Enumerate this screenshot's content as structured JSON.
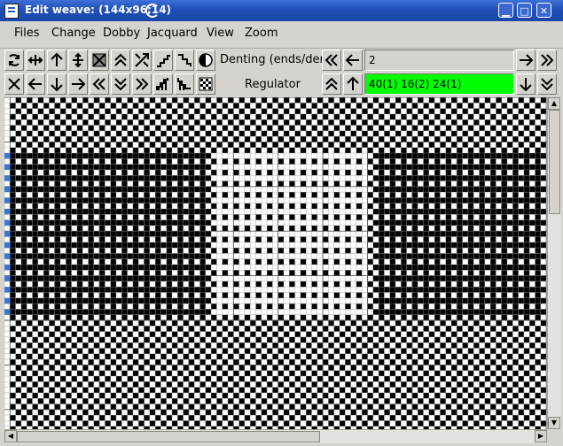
{
  "window": {
    "title": "Edit weave:  (144x96;14)",
    "buttons": [
      "minimize",
      "maximize",
      "close"
    ]
  },
  "menu": [
    "Files",
    "Change",
    "Dobby",
    "Jacquard",
    "View",
    "Zoom"
  ],
  "toolbar": {
    "denting_label": "Denting (ends/dent)",
    "denting_value": "2",
    "regulator_label": "Regulator",
    "regulator_value": "40(1) 16(2) 24(1)",
    "regulator_bg": "#00ff00"
  },
  "toolbar_icons_row1": [
    "rotate-icon",
    "flip-horizontal-icon",
    "arrow-up-icon",
    "flip-vertical-icon",
    "invert-grid-icon",
    "double-up-icon",
    "shrink-diagonal-icon",
    "steps-up-icon",
    "steps-down-icon",
    "half-contrast-icon"
  ],
  "toolbar_icons_row2": [
    "clear-icon",
    "arrow-left-icon",
    "arrow-down-icon",
    "arrow-right-icon",
    "double-left-icon",
    "double-down-icon",
    "double-right-icon",
    "steps-right-icon",
    "steps-left-icon",
    "random-fill-icon"
  ],
  "weave": {
    "weave_color": "#000000",
    "ground_color": "#ffffff",
    "marker_color": "#3a78d8"
  }
}
